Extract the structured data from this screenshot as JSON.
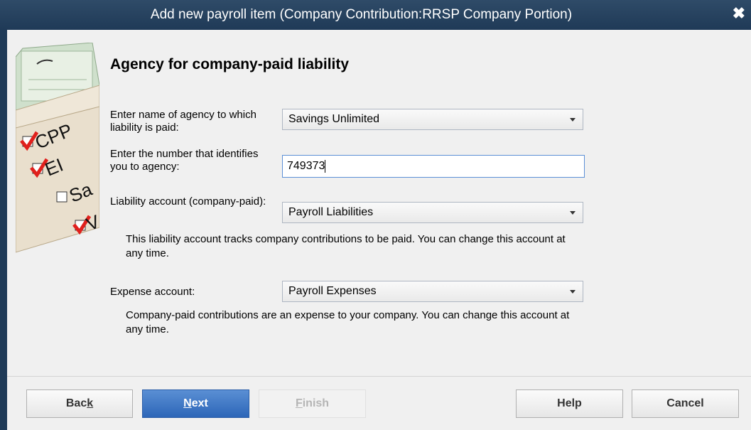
{
  "window": {
    "title": "Add new payroll item (Company Contribution:RRSP Company Portion)",
    "close_glyph": "✖"
  },
  "illustration": {
    "icon": "payroll-checklist-illustration",
    "check_items": [
      "CPP",
      "EI",
      "Sa",
      "V"
    ]
  },
  "page": {
    "heading": "Agency for company-paid liability"
  },
  "fields": {
    "agency_label": "Enter name of agency to which liability is paid:",
    "agency_value": "Savings Unlimited",
    "agency_number_label": "Enter the number that identifies you to agency:",
    "agency_number_value": "749373",
    "liability_label": "Liability account (company-paid):",
    "liability_value": "Payroll Liabilities",
    "liability_note": "This liability account tracks company contributions to be paid. You can change this account at any time.",
    "expense_label": "Expense account:",
    "expense_value": "Payroll Expenses",
    "expense_note": "Company-paid contributions are an expense to your company. You can change this account at any time."
  },
  "buttons": {
    "back": {
      "before": "Bac",
      "accel": "k",
      "after": ""
    },
    "next": {
      "before": "",
      "accel": "N",
      "after": "ext"
    },
    "finish": {
      "before": "",
      "accel": "F",
      "after": "inish"
    },
    "help": "Help",
    "cancel": "Cancel"
  },
  "colors": {
    "titlebar": "#1f3a57",
    "primary_button": "#2d66b8",
    "check_mark": "#e0201c"
  }
}
